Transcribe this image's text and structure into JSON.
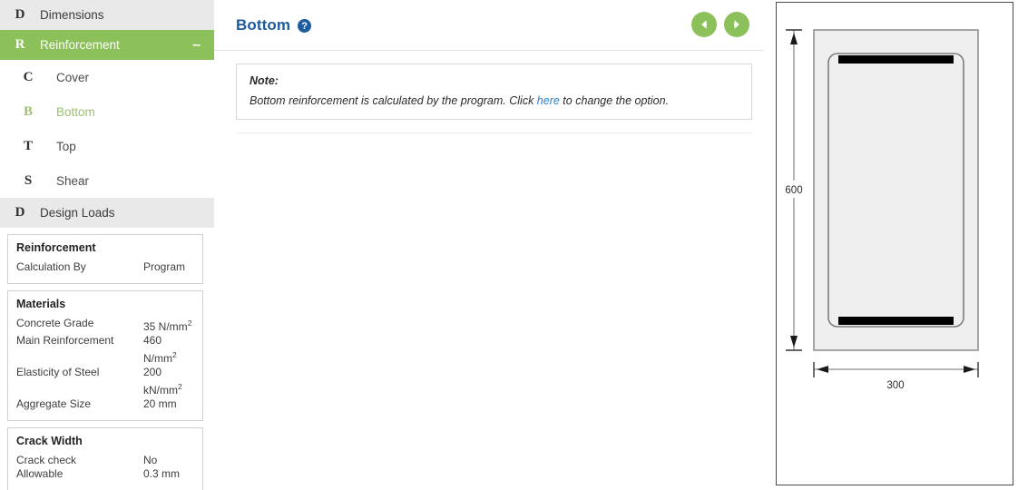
{
  "sidebar": {
    "groups": [
      {
        "icon": "D",
        "label": "Dimensions",
        "active": false,
        "toggle": ""
      },
      {
        "icon": "R",
        "label": "Reinforcement",
        "active": true,
        "toggle": "–"
      }
    ],
    "sub_items": [
      {
        "icon": "C",
        "label": "Cover",
        "selected": false
      },
      {
        "icon": "B",
        "label": "Bottom",
        "selected": true
      },
      {
        "icon": "T",
        "label": "Top",
        "selected": false
      },
      {
        "icon": "S",
        "label": "Shear",
        "selected": false
      }
    ],
    "design_loads": {
      "icon": "D",
      "label": "Design Loads"
    },
    "panels": [
      {
        "title": "Reinforcement",
        "rows": [
          {
            "key": "Calculation By",
            "value": "Program"
          }
        ]
      },
      {
        "title": "Materials",
        "rows": [
          {
            "key": "Concrete Grade",
            "value": "35 N/mm",
            "sup": "2"
          },
          {
            "key": "Main Reinforcement",
            "value": "460 N/mm",
            "sup": "2"
          },
          {
            "key": "Elasticity of Steel",
            "value": "200 kN/mm",
            "sup": "2"
          },
          {
            "key": "Aggregate Size",
            "value": "20 mm",
            "sup": ""
          }
        ]
      },
      {
        "title": "Crack Width",
        "rows": [
          {
            "key": "Crack check",
            "value": "No",
            "sup": ""
          },
          {
            "key": "Allowable",
            "value": "0.3 mm",
            "sup": ""
          }
        ]
      }
    ]
  },
  "main": {
    "title": "Bottom",
    "help_icon": "help-circle-icon",
    "prev_icon": "arrow-left-circle-icon",
    "next_icon": "arrow-right-circle-icon",
    "note": {
      "label": "Note:",
      "text_before": "Bottom reinforcement is calculated by the program. Click ",
      "link": "here",
      "text_after": " to change the option."
    }
  },
  "diagram": {
    "name": "beam-cross-section",
    "height_dim": "600",
    "width_dim": "300",
    "concrete_fill": "#efefef",
    "rebar_color": "#000000"
  },
  "colors": {
    "accent_green": "#8cc05a",
    "title_blue": "#1f5c9e",
    "link_blue": "#2a7fc9",
    "group_bg": "#e9e9e9"
  }
}
